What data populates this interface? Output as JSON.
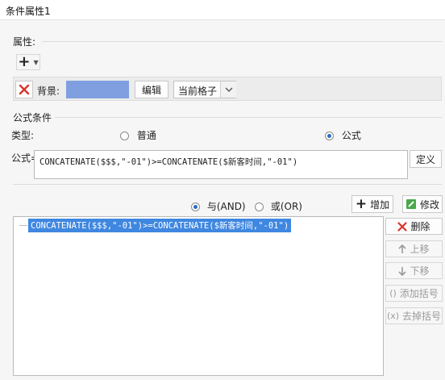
{
  "window": {
    "title": "条件属性1"
  },
  "attributes": {
    "section_label": "属性:",
    "add_button_label": "+",
    "background_label": "背景:",
    "background_color": "#7f9fe0",
    "edit_button_label": "编辑",
    "scope_value": "当前格子"
  },
  "formula_condition": {
    "section_label": "公式条件",
    "type_label": "类型:",
    "type_options": [
      {
        "label": "普通",
        "selected": false
      },
      {
        "label": "公式",
        "selected": true
      }
    ],
    "formula_label": "公式=",
    "formula_value": "CONCATENATE($$$,\"-01\")>=CONCATENATE($新客时间,\"-01\")",
    "define_button_label": "定义",
    "logic_options": [
      {
        "label": "与(AND)",
        "selected": true
      },
      {
        "label": "或(OR)",
        "selected": false
      }
    ],
    "add_button_label": "增加",
    "modify_button_label": "修改",
    "conditions": [
      "CONCATENATE($$$,\"-01\")>=CONCATENATE($新客时间,\"-01\")"
    ],
    "side_buttons": {
      "delete": "删除",
      "move_up": "上移",
      "move_down": "下移",
      "add_brackets": "添加括号",
      "remove_brackets": "去掉括号"
    }
  },
  "colors": {
    "accent_selection": "#3f87e0",
    "delete_icon": "#d9342b"
  }
}
